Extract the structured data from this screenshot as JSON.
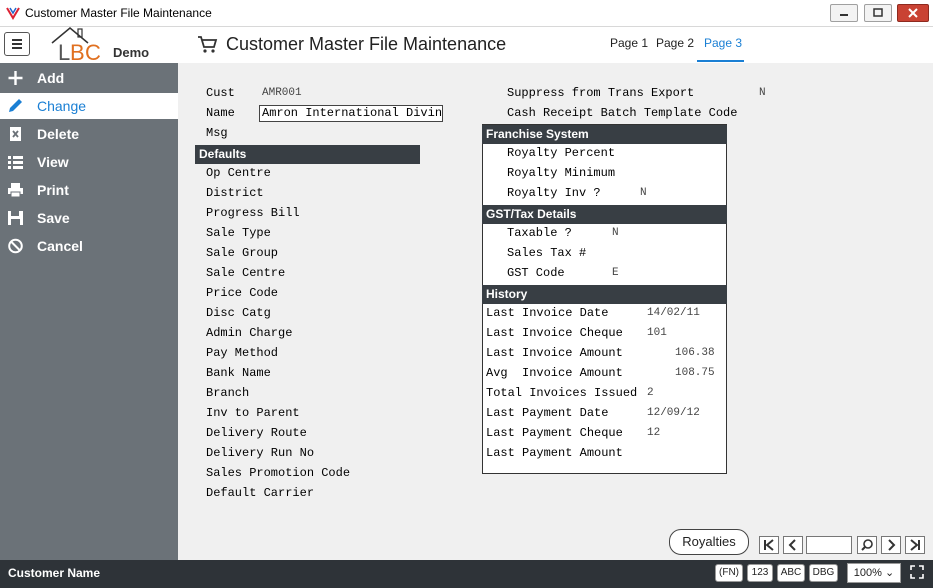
{
  "window": {
    "title": "Customer Master File Maintenance"
  },
  "header": {
    "logo_text": "Demo",
    "page_title": "Customer Master File Maintenance",
    "tabs": [
      {
        "label": "Page 1",
        "active": false
      },
      {
        "label": "Page 2",
        "active": false
      },
      {
        "label": "Page 3",
        "active": true
      }
    ]
  },
  "sidebar": {
    "items": [
      {
        "label": "Add",
        "icon": "plus-icon"
      },
      {
        "label": "Change",
        "icon": "pencil-icon",
        "active": true
      },
      {
        "label": "Delete",
        "icon": "delete-icon"
      },
      {
        "label": "View",
        "icon": "list-icon"
      },
      {
        "label": "Print",
        "icon": "printer-icon"
      },
      {
        "label": "Save",
        "icon": "save-icon"
      },
      {
        "label": "Cancel",
        "icon": "cancel-icon"
      }
    ]
  },
  "form": {
    "cust_label": "Cust",
    "cust_value": "AMR001",
    "name_label": "Name",
    "name_value": "Amron International Divin",
    "msg_label": "Msg",
    "defaults_header": "Defaults",
    "defaults": [
      "Op Centre",
      "District",
      "Progress Bill",
      "Sale Type",
      "Sale Group",
      "Sale Centre",
      "Price Code",
      "Disc Catg",
      "Admin Charge",
      "Pay Method",
      "Bank Name",
      "Branch",
      "Inv to Parent",
      "Delivery Route",
      "Delivery Run No",
      "Sales Promotion Code",
      "Default Carrier"
    ],
    "suppress_label": "Suppress from Trans Export",
    "suppress_value": "N",
    "cash_receipt_label": "Cash Receipt Batch Template Code",
    "franchise": {
      "header": "Franchise System",
      "royalty_percent_label": "Royalty Percent",
      "royalty_minimum_label": "Royalty Minimum",
      "royalty_inv_label": "Royalty Inv ?",
      "royalty_inv_value": "N"
    },
    "gst": {
      "header": "GST/Tax Details",
      "taxable_label": "Taxable ?",
      "taxable_value": "N",
      "sales_tax_label": "Sales Tax #",
      "gst_code_label": "GST Code",
      "gst_code_value": "E"
    },
    "history": {
      "header": "History",
      "rows": [
        {
          "label": "Last Invoice Date",
          "value": "14/02/11"
        },
        {
          "label": "Last Invoice Cheque",
          "value": "101"
        },
        {
          "label": "Last Invoice Amount",
          "value": "106.38"
        },
        {
          "label": "Avg  Invoice Amount",
          "value": "108.75"
        },
        {
          "label": "Total Invoices Issued",
          "value": "2"
        },
        {
          "label": "Last Payment Date",
          "value": "12/09/12"
        },
        {
          "label": "Last Payment Cheque",
          "value": "12"
        },
        {
          "label": "Last Payment Amount",
          "value": ""
        }
      ]
    }
  },
  "footer": {
    "royalties_button": "Royalties"
  },
  "status": {
    "left_text": "Customer Name",
    "buttons": [
      "(FN)",
      "123",
      "ABC",
      "DBG"
    ],
    "zoom": "100%"
  },
  "colors": {
    "accent": "#1a7fd4",
    "sidebar": "#6b7278",
    "section_header": "#383e44",
    "statusbar": "#2e3338"
  }
}
